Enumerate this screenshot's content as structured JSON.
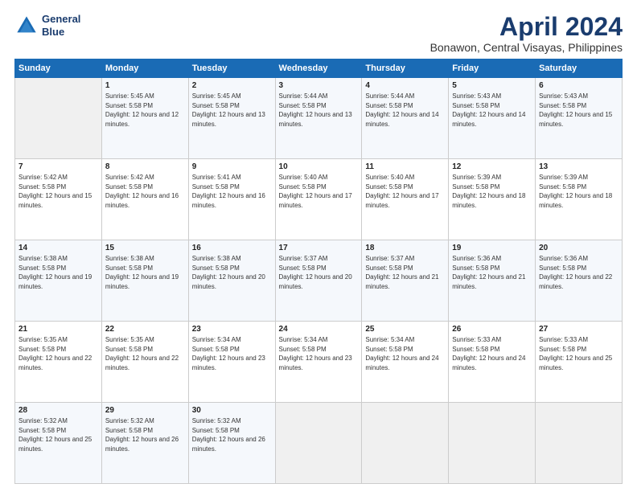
{
  "header": {
    "logo_line1": "General",
    "logo_line2": "Blue",
    "month_year": "April 2024",
    "location": "Bonawon, Central Visayas, Philippines"
  },
  "days_of_week": [
    "Sunday",
    "Monday",
    "Tuesday",
    "Wednesday",
    "Thursday",
    "Friday",
    "Saturday"
  ],
  "weeks": [
    [
      {
        "day": "",
        "empty": true
      },
      {
        "day": "1",
        "sunrise": "Sunrise: 5:45 AM",
        "sunset": "Sunset: 5:58 PM",
        "daylight": "Daylight: 12 hours and 12 minutes."
      },
      {
        "day": "2",
        "sunrise": "Sunrise: 5:45 AM",
        "sunset": "Sunset: 5:58 PM",
        "daylight": "Daylight: 12 hours and 13 minutes."
      },
      {
        "day": "3",
        "sunrise": "Sunrise: 5:44 AM",
        "sunset": "Sunset: 5:58 PM",
        "daylight": "Daylight: 12 hours and 13 minutes."
      },
      {
        "day": "4",
        "sunrise": "Sunrise: 5:44 AM",
        "sunset": "Sunset: 5:58 PM",
        "daylight": "Daylight: 12 hours and 14 minutes."
      },
      {
        "day": "5",
        "sunrise": "Sunrise: 5:43 AM",
        "sunset": "Sunset: 5:58 PM",
        "daylight": "Daylight: 12 hours and 14 minutes."
      },
      {
        "day": "6",
        "sunrise": "Sunrise: 5:43 AM",
        "sunset": "Sunset: 5:58 PM",
        "daylight": "Daylight: 12 hours and 15 minutes."
      }
    ],
    [
      {
        "day": "7",
        "sunrise": "Sunrise: 5:42 AM",
        "sunset": "Sunset: 5:58 PM",
        "daylight": "Daylight: 12 hours and 15 minutes."
      },
      {
        "day": "8",
        "sunrise": "Sunrise: 5:42 AM",
        "sunset": "Sunset: 5:58 PM",
        "daylight": "Daylight: 12 hours and 16 minutes."
      },
      {
        "day": "9",
        "sunrise": "Sunrise: 5:41 AM",
        "sunset": "Sunset: 5:58 PM",
        "daylight": "Daylight: 12 hours and 16 minutes."
      },
      {
        "day": "10",
        "sunrise": "Sunrise: 5:40 AM",
        "sunset": "Sunset: 5:58 PM",
        "daylight": "Daylight: 12 hours and 17 minutes."
      },
      {
        "day": "11",
        "sunrise": "Sunrise: 5:40 AM",
        "sunset": "Sunset: 5:58 PM",
        "daylight": "Daylight: 12 hours and 17 minutes."
      },
      {
        "day": "12",
        "sunrise": "Sunrise: 5:39 AM",
        "sunset": "Sunset: 5:58 PM",
        "daylight": "Daylight: 12 hours and 18 minutes."
      },
      {
        "day": "13",
        "sunrise": "Sunrise: 5:39 AM",
        "sunset": "Sunset: 5:58 PM",
        "daylight": "Daylight: 12 hours and 18 minutes."
      }
    ],
    [
      {
        "day": "14",
        "sunrise": "Sunrise: 5:38 AM",
        "sunset": "Sunset: 5:58 PM",
        "daylight": "Daylight: 12 hours and 19 minutes."
      },
      {
        "day": "15",
        "sunrise": "Sunrise: 5:38 AM",
        "sunset": "Sunset: 5:58 PM",
        "daylight": "Daylight: 12 hours and 19 minutes."
      },
      {
        "day": "16",
        "sunrise": "Sunrise: 5:38 AM",
        "sunset": "Sunset: 5:58 PM",
        "daylight": "Daylight: 12 hours and 20 minutes."
      },
      {
        "day": "17",
        "sunrise": "Sunrise: 5:37 AM",
        "sunset": "Sunset: 5:58 PM",
        "daylight": "Daylight: 12 hours and 20 minutes."
      },
      {
        "day": "18",
        "sunrise": "Sunrise: 5:37 AM",
        "sunset": "Sunset: 5:58 PM",
        "daylight": "Daylight: 12 hours and 21 minutes."
      },
      {
        "day": "19",
        "sunrise": "Sunrise: 5:36 AM",
        "sunset": "Sunset: 5:58 PM",
        "daylight": "Daylight: 12 hours and 21 minutes."
      },
      {
        "day": "20",
        "sunrise": "Sunrise: 5:36 AM",
        "sunset": "Sunset: 5:58 PM",
        "daylight": "Daylight: 12 hours and 22 minutes."
      }
    ],
    [
      {
        "day": "21",
        "sunrise": "Sunrise: 5:35 AM",
        "sunset": "Sunset: 5:58 PM",
        "daylight": "Daylight: 12 hours and 22 minutes."
      },
      {
        "day": "22",
        "sunrise": "Sunrise: 5:35 AM",
        "sunset": "Sunset: 5:58 PM",
        "daylight": "Daylight: 12 hours and 22 minutes."
      },
      {
        "day": "23",
        "sunrise": "Sunrise: 5:34 AM",
        "sunset": "Sunset: 5:58 PM",
        "daylight": "Daylight: 12 hours and 23 minutes."
      },
      {
        "day": "24",
        "sunrise": "Sunrise: 5:34 AM",
        "sunset": "Sunset: 5:58 PM",
        "daylight": "Daylight: 12 hours and 23 minutes."
      },
      {
        "day": "25",
        "sunrise": "Sunrise: 5:34 AM",
        "sunset": "Sunset: 5:58 PM",
        "daylight": "Daylight: 12 hours and 24 minutes."
      },
      {
        "day": "26",
        "sunrise": "Sunrise: 5:33 AM",
        "sunset": "Sunset: 5:58 PM",
        "daylight": "Daylight: 12 hours and 24 minutes."
      },
      {
        "day": "27",
        "sunrise": "Sunrise: 5:33 AM",
        "sunset": "Sunset: 5:58 PM",
        "daylight": "Daylight: 12 hours and 25 minutes."
      }
    ],
    [
      {
        "day": "28",
        "sunrise": "Sunrise: 5:32 AM",
        "sunset": "Sunset: 5:58 PM",
        "daylight": "Daylight: 12 hours and 25 minutes."
      },
      {
        "day": "29",
        "sunrise": "Sunrise: 5:32 AM",
        "sunset": "Sunset: 5:58 PM",
        "daylight": "Daylight: 12 hours and 26 minutes."
      },
      {
        "day": "30",
        "sunrise": "Sunrise: 5:32 AM",
        "sunset": "Sunset: 5:58 PM",
        "daylight": "Daylight: 12 hours and 26 minutes."
      },
      {
        "day": "",
        "empty": true
      },
      {
        "day": "",
        "empty": true
      },
      {
        "day": "",
        "empty": true
      },
      {
        "day": "",
        "empty": true
      }
    ]
  ]
}
